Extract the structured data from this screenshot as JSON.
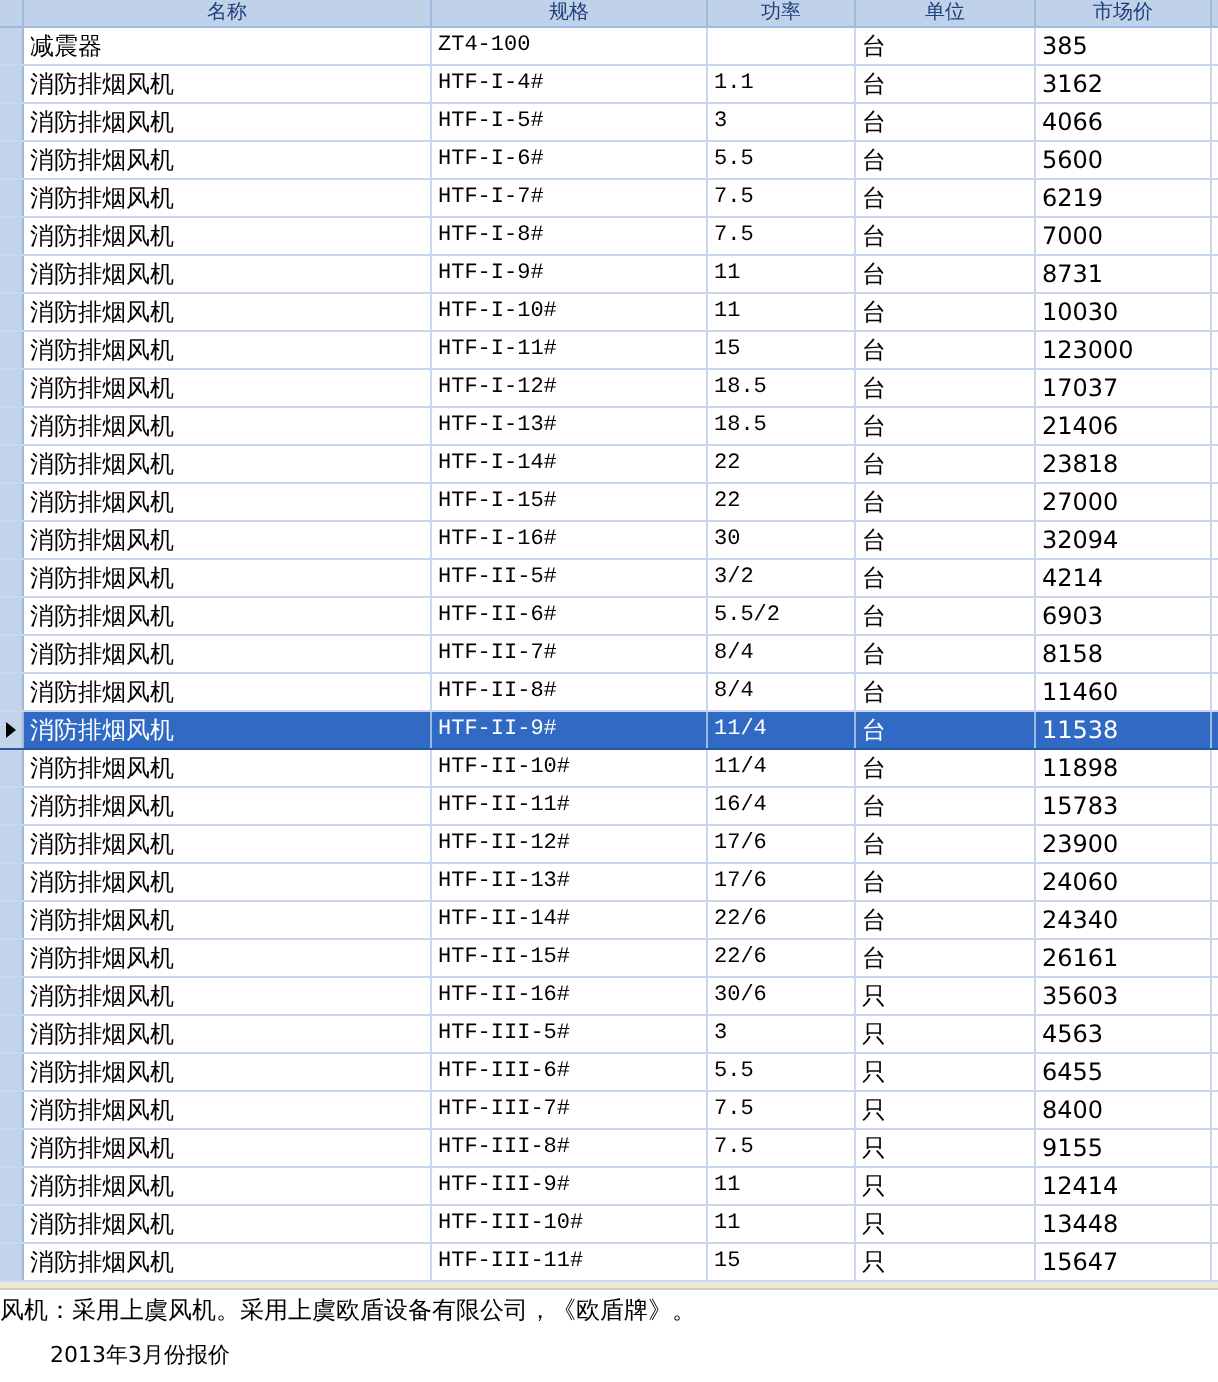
{
  "table": {
    "columns": [
      "名称",
      "规格",
      "功率",
      "单位",
      "市场价"
    ],
    "rows": [
      {
        "name": "减震器",
        "spec": "ZT4-100",
        "power": "",
        "unit": "台",
        "price": "385",
        "selected": false
      },
      {
        "name": "消防排烟风机",
        "spec": "HTF-I-4#",
        "power": "1.1",
        "unit": "台",
        "price": "3162",
        "selected": false
      },
      {
        "name": "消防排烟风机",
        "spec": "HTF-I-5#",
        "power": "3",
        "unit": "台",
        "price": "4066",
        "selected": false
      },
      {
        "name": "消防排烟风机",
        "spec": "HTF-I-6#",
        "power": "5.5",
        "unit": "台",
        "price": "5600",
        "selected": false
      },
      {
        "name": "消防排烟风机",
        "spec": "HTF-I-7#",
        "power": "7.5",
        "unit": "台",
        "price": "6219",
        "selected": false
      },
      {
        "name": "消防排烟风机",
        "spec": "HTF-I-8#",
        "power": "7.5",
        "unit": "台",
        "price": "7000",
        "selected": false
      },
      {
        "name": "消防排烟风机",
        "spec": "HTF-I-9#",
        "power": "11",
        "unit": "台",
        "price": "8731",
        "selected": false
      },
      {
        "name": "消防排烟风机",
        "spec": "HTF-I-10#",
        "power": "11",
        "unit": "台",
        "price": "10030",
        "selected": false
      },
      {
        "name": "消防排烟风机",
        "spec": "HTF-I-11#",
        "power": "15",
        "unit": "台",
        "price": "123000",
        "selected": false
      },
      {
        "name": "消防排烟风机",
        "spec": "HTF-I-12#",
        "power": "18.5",
        "unit": "台",
        "price": "17037",
        "selected": false
      },
      {
        "name": "消防排烟风机",
        "spec": "HTF-I-13#",
        "power": "18.5",
        "unit": "台",
        "price": "21406",
        "selected": false
      },
      {
        "name": "消防排烟风机",
        "spec": "HTF-I-14#",
        "power": "22",
        "unit": "台",
        "price": "23818",
        "selected": false
      },
      {
        "name": "消防排烟风机",
        "spec": "HTF-I-15#",
        "power": "22",
        "unit": "台",
        "price": "27000",
        "selected": false
      },
      {
        "name": "消防排烟风机",
        "spec": "HTF-I-16#",
        "power": "30",
        "unit": "台",
        "price": "32094",
        "selected": false
      },
      {
        "name": "消防排烟风机",
        "spec": "HTF-II-5#",
        "power": "3/2",
        "unit": "台",
        "price": "4214",
        "selected": false
      },
      {
        "name": "消防排烟风机",
        "spec": "HTF-II-6#",
        "power": "5.5/2",
        "unit": "台",
        "price": "6903",
        "selected": false
      },
      {
        "name": "消防排烟风机",
        "spec": "HTF-II-7#",
        "power": "8/4",
        "unit": "台",
        "price": "8158",
        "selected": false
      },
      {
        "name": "消防排烟风机",
        "spec": "HTF-II-8#",
        "power": "8/4",
        "unit": "台",
        "price": "11460",
        "selected": false
      },
      {
        "name": "消防排烟风机",
        "spec": "HTF-II-9#",
        "power": "11/4",
        "unit": "台",
        "price": "11538",
        "selected": true
      },
      {
        "name": "消防排烟风机",
        "spec": "HTF-II-10#",
        "power": "11/4",
        "unit": "台",
        "price": "11898",
        "selected": false
      },
      {
        "name": "消防排烟风机",
        "spec": "HTF-II-11#",
        "power": "16/4",
        "unit": "台",
        "price": "15783",
        "selected": false
      },
      {
        "name": "消防排烟风机",
        "spec": "HTF-II-12#",
        "power": "17/6",
        "unit": "台",
        "price": "23900",
        "selected": false
      },
      {
        "name": "消防排烟风机",
        "spec": "HTF-II-13#",
        "power": "17/6",
        "unit": "台",
        "price": "24060",
        "selected": false
      },
      {
        "name": "消防排烟风机",
        "spec": "HTF-II-14#",
        "power": "22/6",
        "unit": "台",
        "price": "24340",
        "selected": false
      },
      {
        "name": "消防排烟风机",
        "spec": "HTF-II-15#",
        "power": "22/6",
        "unit": "台",
        "price": "26161",
        "selected": false
      },
      {
        "name": "消防排烟风机",
        "spec": "HTF-II-16#",
        "power": "30/6",
        "unit": "只",
        "price": "35603",
        "selected": false
      },
      {
        "name": "消防排烟风机",
        "spec": "HTF-III-5#",
        "power": "3",
        "unit": "只",
        "price": "4563",
        "selected": false
      },
      {
        "name": "消防排烟风机",
        "spec": "HTF-III-6#",
        "power": "5.5",
        "unit": "只",
        "price": "6455",
        "selected": false
      },
      {
        "name": "消防排烟风机",
        "spec": "HTF-III-7#",
        "power": "7.5",
        "unit": "只",
        "price": "8400",
        "selected": false
      },
      {
        "name": "消防排烟风机",
        "spec": "HTF-III-8#",
        "power": "7.5",
        "unit": "只",
        "price": "9155",
        "selected": false
      },
      {
        "name": "消防排烟风机",
        "spec": "HTF-III-9#",
        "power": "11",
        "unit": "只",
        "price": "12414",
        "selected": false
      },
      {
        "name": "消防排烟风机",
        "spec": "HTF-III-10#",
        "power": "11",
        "unit": "只",
        "price": "13448",
        "selected": false
      },
      {
        "name": "消防排烟风机",
        "spec": "HTF-III-11#",
        "power": "15",
        "unit": "只",
        "price": "15647",
        "selected": false
      }
    ]
  },
  "note": "风机：采用上虞风机。采用上虞欧盾设备有限公司，《欧盾牌》。",
  "date": "2013年3月份报价"
}
